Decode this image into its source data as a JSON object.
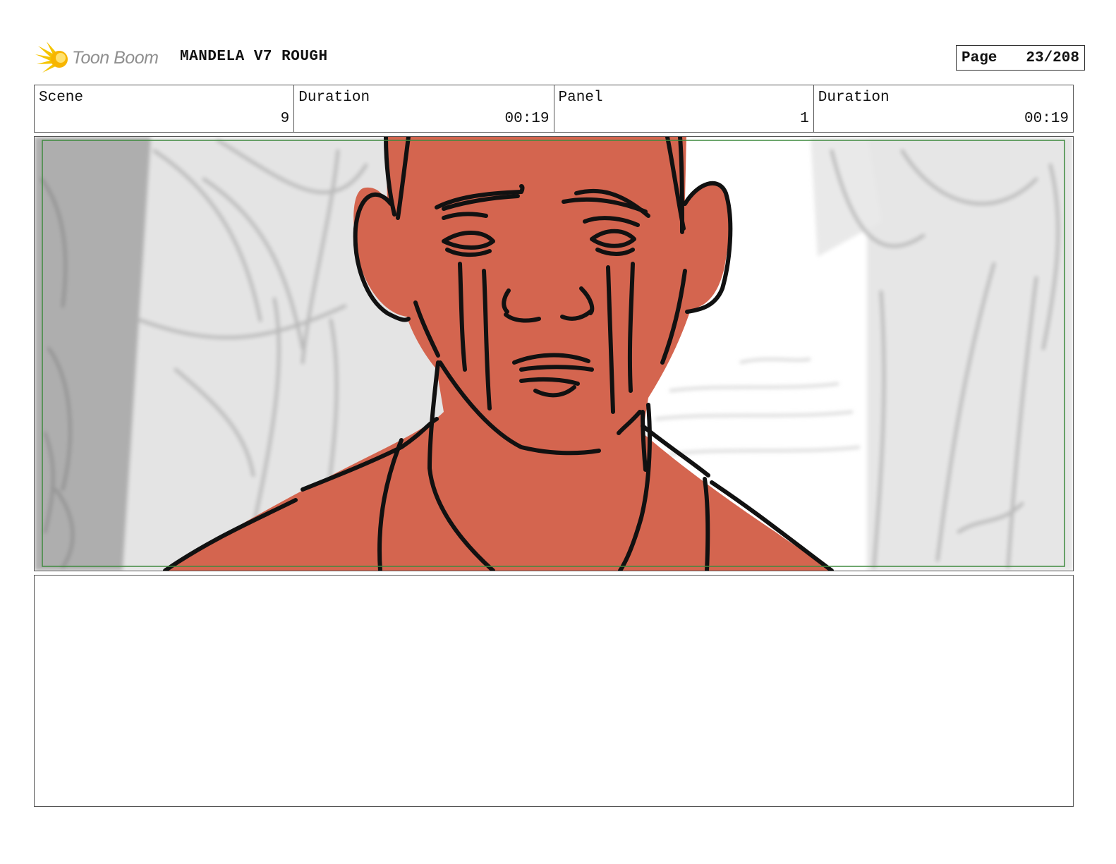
{
  "header": {
    "logo_text": "Toon Boom",
    "project_title": "MANDELA V7 ROUGH",
    "page_label": "Page",
    "page_number": "23/208"
  },
  "info": {
    "scene_label": "Scene",
    "scene_value": "9",
    "scene_duration_label": "Duration",
    "scene_duration_value": "00:19",
    "panel_label": "Panel",
    "panel_value": "1",
    "panel_duration_label": "Duration",
    "panel_duration_value": "00:19"
  },
  "panel": {
    "safe_frame_color": "#3f8a3f",
    "skin_color": "#d4654f",
    "line_color": "#111111"
  },
  "notes": {
    "text": ""
  }
}
